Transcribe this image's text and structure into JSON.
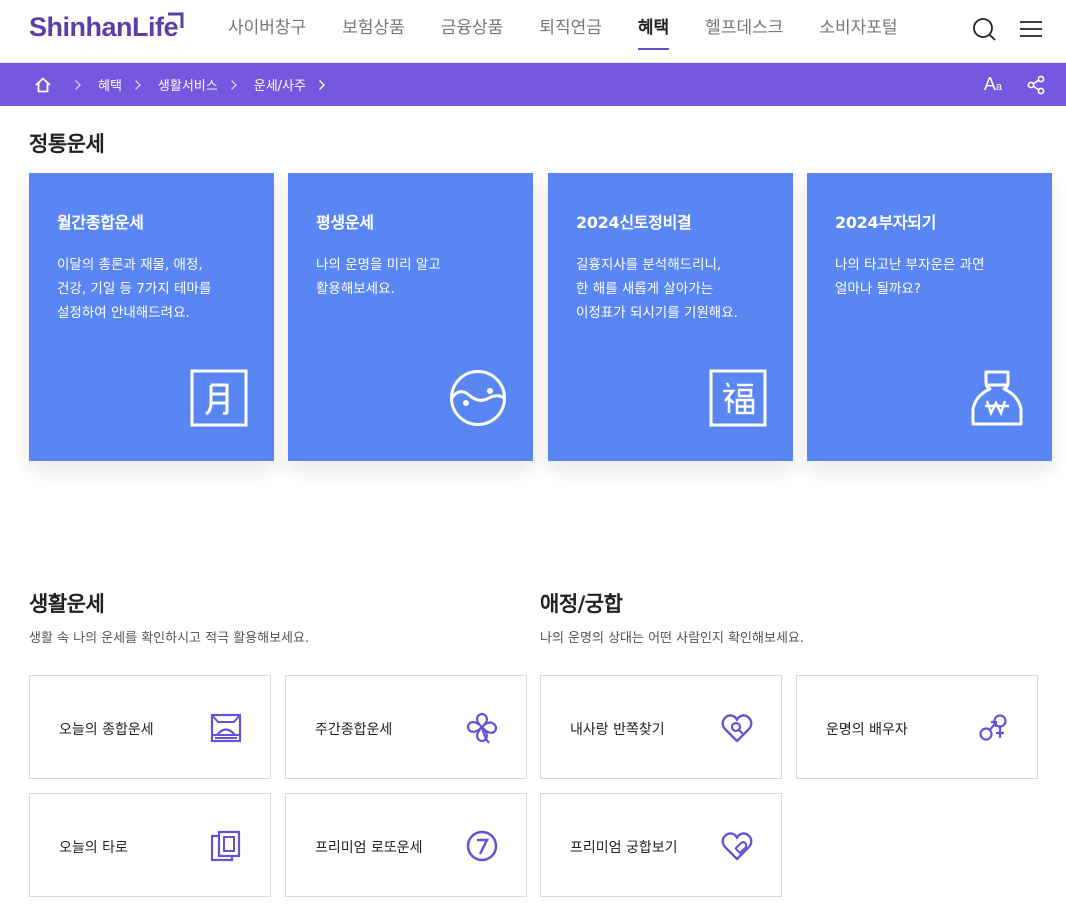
{
  "header": {
    "logo": "ShinhanLife",
    "nav": [
      {
        "label": "사이버창구",
        "active": false
      },
      {
        "label": "보험상품",
        "active": false
      },
      {
        "label": "금융상품",
        "active": false
      },
      {
        "label": "퇴직연금",
        "active": false
      },
      {
        "label": "혜택",
        "active": true
      },
      {
        "label": "헬프데스크",
        "active": false
      },
      {
        "label": "소비자포털",
        "active": false
      }
    ],
    "icons": [
      "search-icon",
      "menu-icon"
    ]
  },
  "breadcrumb": {
    "home_icon": "home-icon",
    "items": [
      "혜택",
      "생활서비스",
      "운세/사주"
    ],
    "font_size_label": "A",
    "font_size_small": "a",
    "share_icon": "share-icon"
  },
  "colors": {
    "brand": "#5b3fa6",
    "bar": "#7658e0",
    "card": "#5a86f4",
    "icon_accent": "#6a4fd8"
  },
  "traditional": {
    "title": "정통운세",
    "cards": [
      {
        "title": "월간종합운세",
        "desc": "이달의 총론과 재물, 애정,\n건강, 기일 등 7가지 테마를\n설정하여 안내해드려요.",
        "icon": "moon-character-icon"
      },
      {
        "title": "평생운세",
        "desc": "나의 운명을 미리 알고\n활용해보세요.",
        "icon": "yin-yang-icon"
      },
      {
        "title": "2024신토정비결",
        "desc": "길흉지사를 분석해드리니,\n한 해를 새롭게 살아가는\n이정표가 되시기를 기원해요.",
        "icon": "fortune-character-icon"
      },
      {
        "title": "2024부자되기",
        "desc": "나의 타고난 부자운은 과연\n얼마나 될까요?",
        "icon": "money-bag-icon"
      }
    ]
  },
  "life": {
    "title": "생활운세",
    "desc": "생활 속 나의 운세를 확인하시고 적극 활용해보세요.",
    "tiles": [
      {
        "label": "오늘의 종합운세",
        "icon": "sunrise-icon"
      },
      {
        "label": "주간종합운세",
        "icon": "clover-icon"
      },
      {
        "label": "오늘의 타로",
        "icon": "tarot-cards-icon"
      },
      {
        "label": "프리미엄 로또운세",
        "icon": "lotto-ball-icon"
      }
    ]
  },
  "love": {
    "title": "애정/궁합",
    "desc": "나의 운명의 상대는 어떤 사람인지 확인해보세요.",
    "tiles": [
      {
        "label": "내사랑 반쪽찾기",
        "icon": "heart-search-icon"
      },
      {
        "label": "운명의 배우자",
        "icon": "gender-symbol-icon"
      },
      {
        "label": "프리미엄 궁합보기",
        "icon": "heart-check-icon"
      }
    ]
  }
}
